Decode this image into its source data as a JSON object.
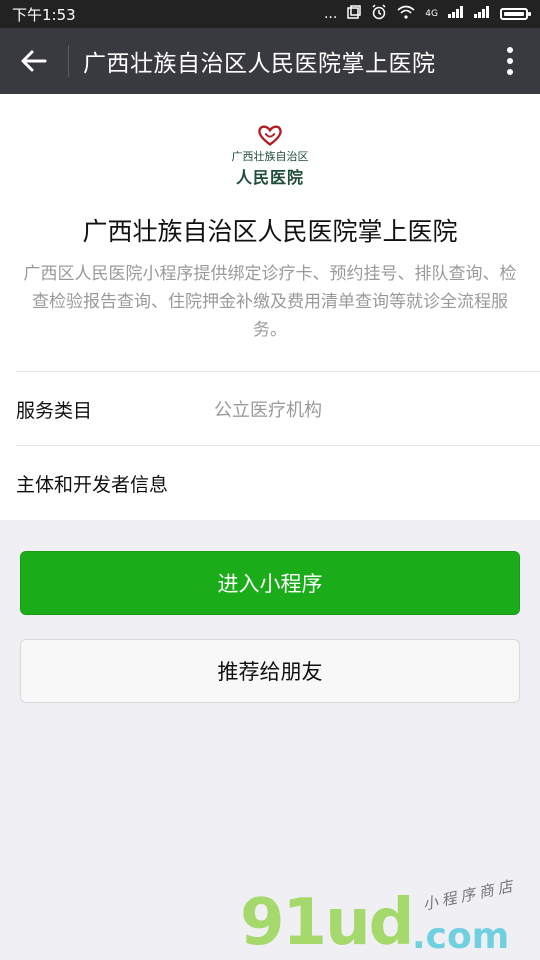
{
  "status_bar": {
    "time": "下午1:53",
    "network_label": "4G",
    "dots": "..."
  },
  "header": {
    "title": "广西壮族自治区人民医院掌上医院"
  },
  "app": {
    "logo_text_top": "广西壮族自治区",
    "logo_text_main": "人民医院",
    "name": "广西壮族自治区人民医院掌上医院",
    "description": "广西区人民医院小程序提供绑定诊疗卡、预约挂号、排队查询、检查检验报告查询、住院押金补缴及费用清单查询等就诊全流程服务。"
  },
  "info_rows": [
    {
      "label": "服务类目",
      "value": "公立医疗机构"
    },
    {
      "label": "主体和开发者信息",
      "value": ""
    }
  ],
  "buttons": {
    "enter": "进入小程序",
    "share": "推荐给朋友"
  },
  "watermark": {
    "main": "91ud",
    "domain": ".com",
    "tagline": "小程序商店"
  },
  "colors": {
    "primary_green": "#1aad19",
    "nav_bg": "#393a3f",
    "status_bg": "#222222",
    "logo_red": "#b01f24",
    "logo_green": "#1f4d3a"
  }
}
